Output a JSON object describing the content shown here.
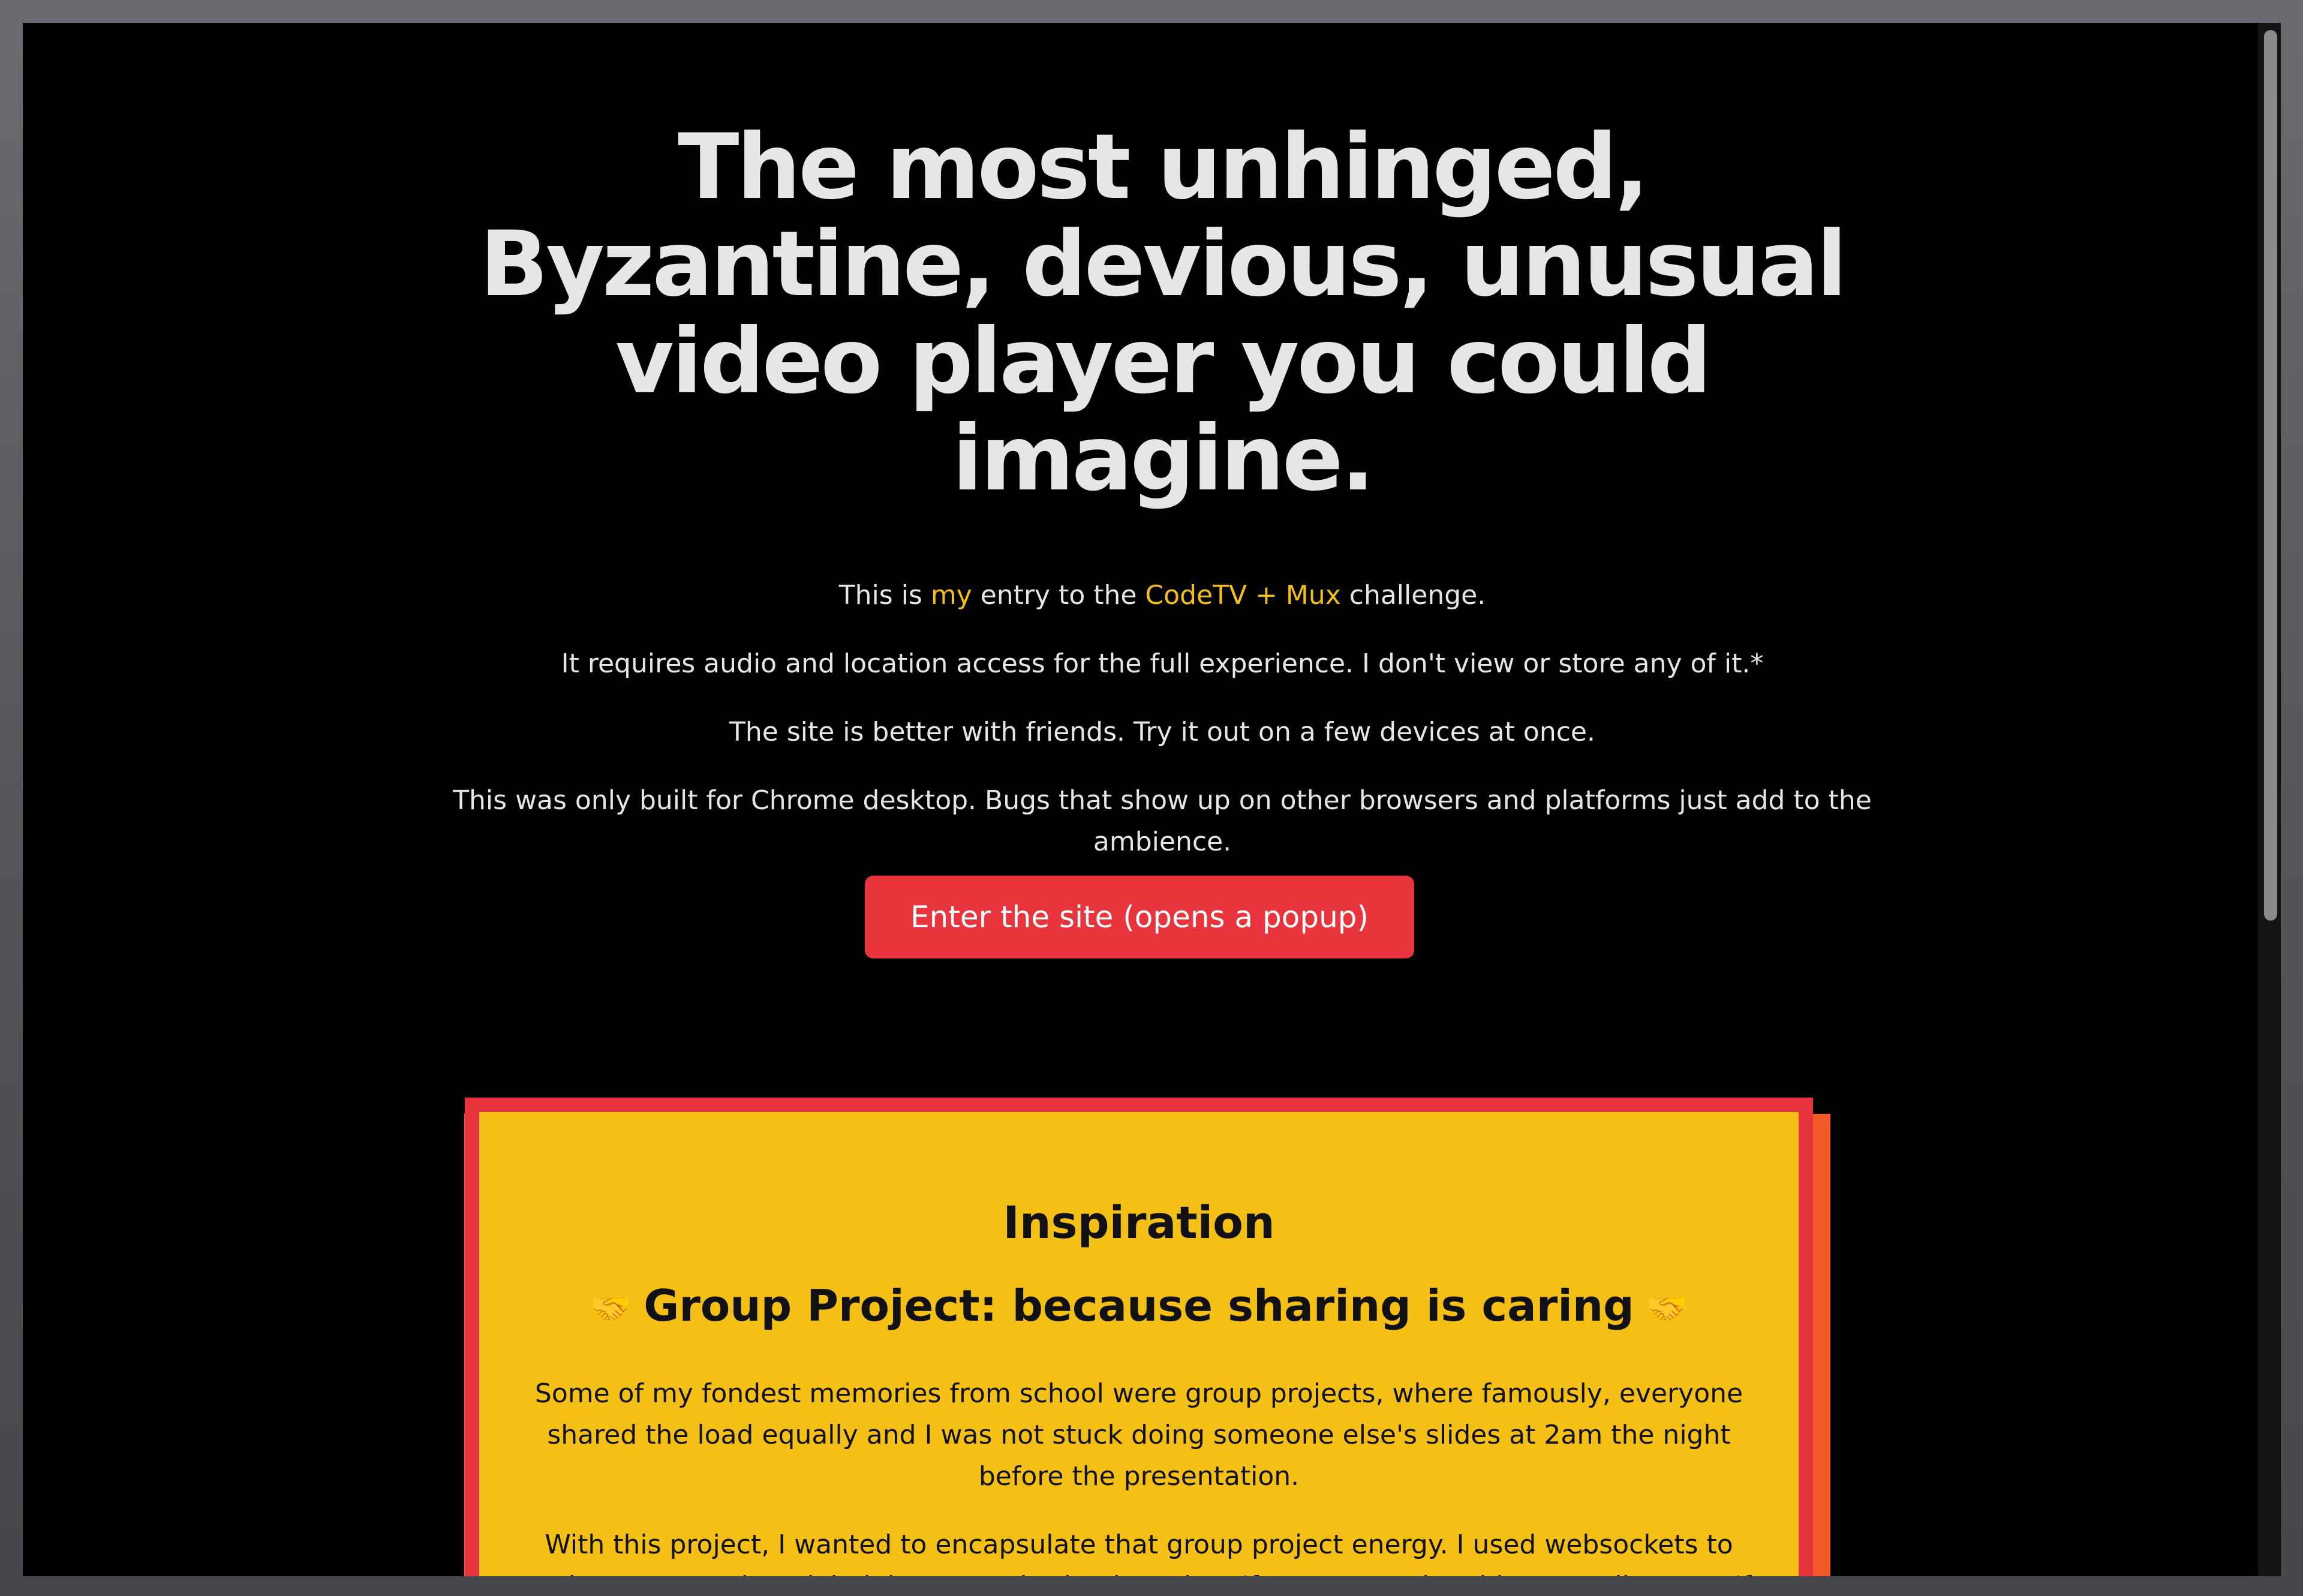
{
  "hero": {
    "title": "The most unhinged, Byzantine, devious, unusual video player you could imagine."
  },
  "intro": {
    "line1_prefix": "This is ",
    "line1_link_my": "my",
    "line1_mid": " entry to the ",
    "line1_link_challenge": "CodeTV + Mux",
    "line1_suffix": " challenge.",
    "line2": "It requires audio and location access for the full experience. I don't view or store any of it.*",
    "line3": "The site is better with friends. Try it out on a few devices at once.",
    "line4": "This was only built for Chrome desktop. Bugs that show up on other browsers and platforms just add to the ambience."
  },
  "enter_button": {
    "label": "Enter the site (opens a popup)"
  },
  "inspiration": {
    "heading": "Inspiration",
    "subheading": "Group Project: because sharing is caring",
    "emoji_left": "🤝",
    "emoji_right": "🤝",
    "paragraph1": "Some of my fondest memories from school were group projects, where famously, everyone shared the load equally and I was not stuck doing someone else's slides at 2am the night before the presentation.",
    "paragraph2": "With this project, I wanted to encapsulate that group project energy. I used websockets to make every setting global, because sharing is caring. If you pause the video, we all pause. If"
  },
  "colors": {
    "background": "#000000",
    "text": "#e6e6e6",
    "accent_yellow": "#f5c016",
    "accent_red": "#e8343c",
    "accent_orange": "#f25a29"
  }
}
